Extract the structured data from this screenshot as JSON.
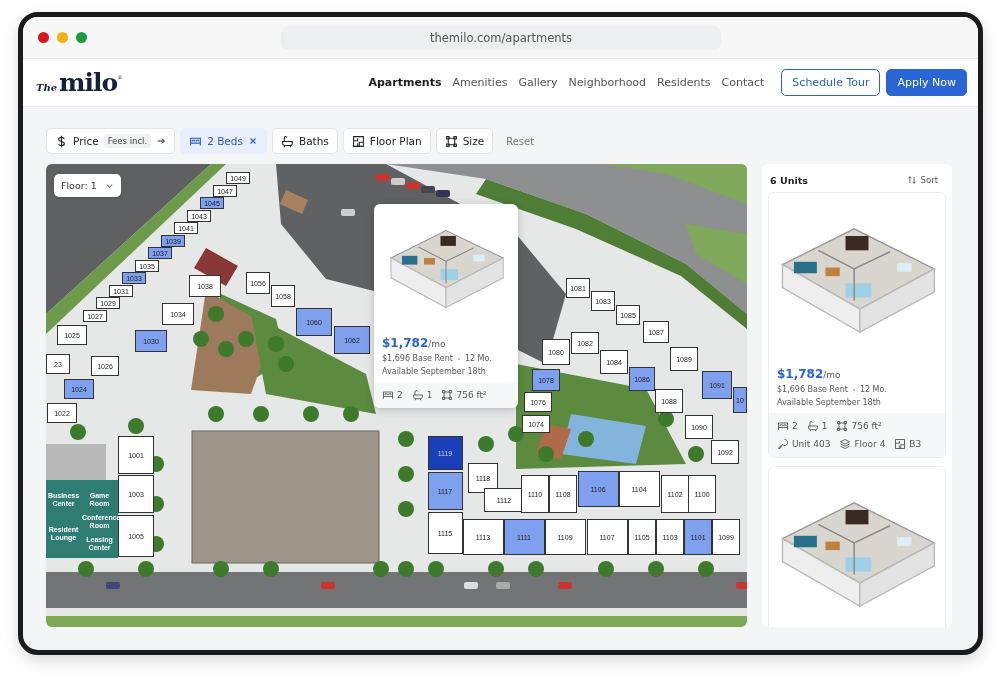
{
  "browser": {
    "url": "themilo.com/apartments"
  },
  "logo": {
    "prefix": "The",
    "name": "milo",
    "mark": "®"
  },
  "nav": [
    {
      "label": "Apartments",
      "selected": true
    },
    {
      "label": "Amenities",
      "selected": false
    },
    {
      "label": "Gallery",
      "selected": false
    },
    {
      "label": "Neighborhood",
      "selected": false
    },
    {
      "label": "Residents",
      "selected": false
    },
    {
      "label": "Contact",
      "selected": false
    }
  ],
  "header_buttons": [
    {
      "label": "Schedule Tour",
      "kind": "outline"
    },
    {
      "label": "Apply Now",
      "kind": "primary"
    }
  ],
  "filters": [
    {
      "label": "Price",
      "kind": "price",
      "tag": "Fees incl.",
      "selected": false
    },
    {
      "label": "2 Beds",
      "kind": "beds",
      "selected": true
    },
    {
      "label": "Baths",
      "kind": "baths",
      "selected": false
    },
    {
      "label": "Floor Plan",
      "kind": "plan",
      "selected": false
    },
    {
      "label": "Size",
      "kind": "size",
      "selected": false
    }
  ],
  "reset": "Reset",
  "map": {
    "floor_select": "Floor: 1",
    "units": [
      {
        "label": "1049",
        "available": false,
        "selected": false
      },
      {
        "label": "1047",
        "available": false,
        "selected": false
      },
      {
        "label": "1045",
        "available": true,
        "selected": false
      },
      {
        "label": "1043",
        "available": false,
        "selected": false
      },
      {
        "label": "1041",
        "available": false,
        "selected": false
      },
      {
        "label": "1039",
        "available": true,
        "selected": false
      },
      {
        "label": "1037",
        "available": true,
        "selected": false
      },
      {
        "label": "1035",
        "available": false,
        "selected": false
      },
      {
        "label": "1033",
        "available": true,
        "selected": false
      },
      {
        "label": "1031",
        "available": false,
        "selected": false
      },
      {
        "label": "1029",
        "available": false,
        "selected": false
      },
      {
        "label": "1027",
        "available": false,
        "selected": false
      },
      {
        "label": "1025",
        "available": false,
        "selected": false
      },
      {
        "label": "23",
        "available": false,
        "selected": false
      },
      {
        "label": "1024",
        "available": true,
        "selected": false
      },
      {
        "label": "1026",
        "available": false,
        "selected": false
      },
      {
        "label": "1030",
        "available": true,
        "selected": false
      },
      {
        "label": "1034",
        "available": false,
        "selected": false
      },
      {
        "label": "1038",
        "available": false,
        "selected": false
      },
      {
        "label": "1022",
        "available": false,
        "selected": false
      },
      {
        "label": "1056",
        "available": false,
        "selected": false
      },
      {
        "label": "1058",
        "available": false,
        "selected": false
      },
      {
        "label": "1060",
        "available": true,
        "selected": false
      },
      {
        "label": "1062",
        "available": true,
        "selected": false
      },
      {
        "label": "1081",
        "available": false,
        "selected": false
      },
      {
        "label": "1083",
        "available": false,
        "selected": false
      },
      {
        "label": "1085",
        "available": false,
        "selected": false
      },
      {
        "label": "1087",
        "available": false,
        "selected": false
      },
      {
        "label": "1089",
        "available": false,
        "selected": false
      },
      {
        "label": "1080",
        "available": false,
        "selected": false
      },
      {
        "label": "1082",
        "available": false,
        "selected": false
      },
      {
        "label": "1084",
        "available": false,
        "selected": false
      },
      {
        "label": "1086",
        "available": true,
        "selected": false
      },
      {
        "label": "1078",
        "available": true,
        "selected": false
      },
      {
        "label": "1076",
        "available": false,
        "selected": false
      },
      {
        "label": "1074",
        "available": false,
        "selected": false
      },
      {
        "label": "1091",
        "available": true,
        "selected": false
      },
      {
        "label": "1088",
        "available": false,
        "selected": false
      },
      {
        "label": "1090",
        "available": false,
        "selected": false
      },
      {
        "label": "1092",
        "available": false,
        "selected": false
      },
      {
        "label": "10",
        "available": true,
        "selected": false
      },
      {
        "label": "1001",
        "available": false,
        "selected": false
      },
      {
        "label": "1003",
        "available": false,
        "selected": false
      },
      {
        "label": "1005",
        "available": false,
        "selected": false
      },
      {
        "label": "1119",
        "available": true,
        "selected": true
      },
      {
        "label": "1117",
        "available": true,
        "selected": false
      },
      {
        "label": "1118",
        "available": false,
        "selected": false
      },
      {
        "label": "1112",
        "available": false,
        "selected": false
      },
      {
        "label": "1110",
        "available": false,
        "selected": false
      },
      {
        "label": "1108",
        "available": false,
        "selected": false
      },
      {
        "label": "1106",
        "available": true,
        "selected": false
      },
      {
        "label": "1104",
        "available": false,
        "selected": false
      },
      {
        "label": "1102",
        "available": false,
        "selected": false
      },
      {
        "label": "1100",
        "available": false,
        "selected": false
      },
      {
        "label": "1115",
        "available": false,
        "selected": false
      },
      {
        "label": "1113",
        "available": false,
        "selected": false
      },
      {
        "label": "1111",
        "available": true,
        "selected": false
      },
      {
        "label": "1109",
        "available": false,
        "selected": false
      },
      {
        "label": "1107",
        "available": false,
        "selected": false
      },
      {
        "label": "1105",
        "available": false,
        "selected": false
      },
      {
        "label": "1103",
        "available": false,
        "selected": false
      },
      {
        "label": "1101",
        "available": true,
        "selected": false
      },
      {
        "label": "1099",
        "available": false,
        "selected": false
      }
    ],
    "amenities": [
      "Business Center",
      "Game Room",
      "Conference Room",
      "Resident Lounge",
      "Leasing Center"
    ],
    "popup": {
      "price": "$1,782",
      "per": "/mo",
      "base_rent": "$1,696 Base Rent",
      "term": "12 Mo.",
      "available": "Available September 18th",
      "specs": [
        {
          "kind": "beds",
          "text": "2"
        },
        {
          "kind": "baths",
          "text": "1"
        },
        {
          "kind": "size",
          "text": "756 ft²"
        }
      ]
    }
  },
  "results": {
    "count": "6 Units",
    "sort": "Sort",
    "cards": [
      {
        "kind": "full",
        "price": "$1,782",
        "per": "/mo",
        "base_rent": "$1,696 Base Rent",
        "term": "12 Mo.",
        "available": "Available September 18th",
        "specs": [
          {
            "kind": "beds",
            "text": "2"
          },
          {
            "kind": "baths",
            "text": "1"
          },
          {
            "kind": "size",
            "text": "756 ft²"
          },
          {
            "kind": "unit",
            "text": "Unit 403"
          },
          {
            "kind": "floor",
            "text": "Floor 4"
          },
          {
            "kind": "plan",
            "text": "B3"
          }
        ]
      },
      {
        "kind": "image"
      }
    ]
  }
}
